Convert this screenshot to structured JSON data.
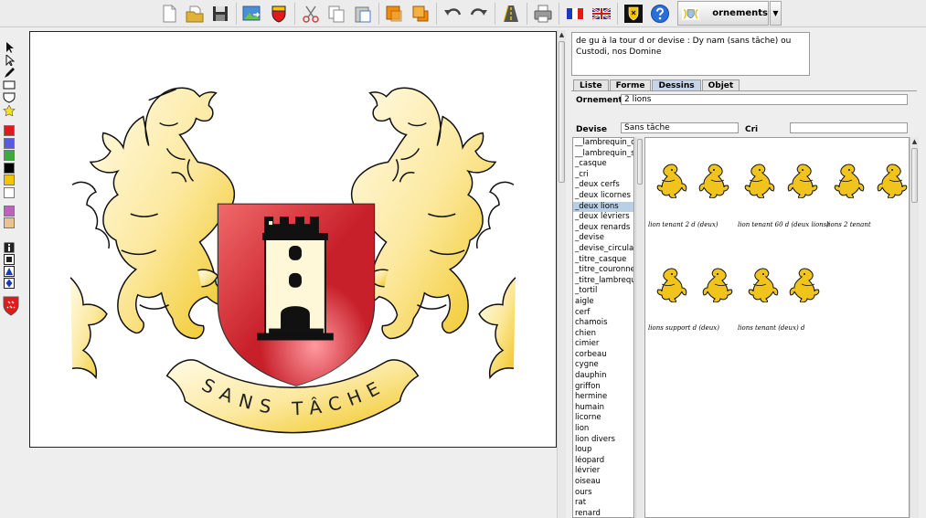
{
  "toolbar": {
    "buttons": [
      {
        "name": "new-document-icon"
      },
      {
        "name": "open-folder-icon"
      },
      {
        "name": "save-icon"
      },
      {
        "name": "export-image-icon"
      },
      {
        "name": "shield-icon"
      },
      {
        "name": "cut-icon"
      },
      {
        "name": "copy-icon"
      },
      {
        "name": "paste-icon"
      },
      {
        "name": "bring-forward-icon"
      },
      {
        "name": "send-backward-icon"
      },
      {
        "name": "undo-icon"
      },
      {
        "name": "redo-icon"
      },
      {
        "name": "road-icon"
      },
      {
        "name": "print-icon"
      },
      {
        "name": "french-flag-icon"
      },
      {
        "name": "uk-flag-icon"
      },
      {
        "name": "coat-of-arms-icon"
      },
      {
        "name": "help-icon"
      }
    ],
    "ornaments_label": "ornements"
  },
  "colors": {
    "palette": [
      "#e31a1a",
      "#5a5ae0",
      "#35b035",
      "#000000",
      "#f5c400",
      "#ffffff",
      "#c060c0",
      "#e8c48c"
    ],
    "shield": "#c8202a",
    "gold": "#f0c41c"
  },
  "blazon": "de gu à la tour d or devise : Dy nam (sans tâche) ou Custodi, nos Domine",
  "tabs": [
    {
      "label": "Liste",
      "active": false
    },
    {
      "label": "Forme",
      "active": false
    },
    {
      "label": "Dessins",
      "active": true
    },
    {
      "label": "Objet",
      "active": false
    }
  ],
  "fields": {
    "ornements_label": "Ornements",
    "ornements_value": "2 lions",
    "devise_label": "Devise",
    "devise_value": "Sans tâche",
    "cri_label": "Cri",
    "cri_value": ""
  },
  "motto": "SANS TÂCHE",
  "list_items": [
    {
      "label": "__lambrequin_c",
      "selected": false
    },
    {
      "label": "__lambrequin_sc",
      "selected": false
    },
    {
      "label": "_casque",
      "selected": false
    },
    {
      "label": "_cri",
      "selected": false
    },
    {
      "label": "_deux cerfs",
      "selected": false
    },
    {
      "label": "_deux licornes",
      "selected": false
    },
    {
      "label": "_deux lions",
      "selected": true
    },
    {
      "label": "_deux lévriers",
      "selected": false
    },
    {
      "label": "_deux renards",
      "selected": false
    },
    {
      "label": "_devise",
      "selected": false
    },
    {
      "label": "_devise_circulaire",
      "selected": false
    },
    {
      "label": "_titre_casque",
      "selected": false
    },
    {
      "label": "_titre_couronne",
      "selected": false
    },
    {
      "label": "_titre_lambrequin",
      "selected": false
    },
    {
      "label": "_tortil",
      "selected": false
    },
    {
      "label": "aigle",
      "selected": false
    },
    {
      "label": "cerf",
      "selected": false
    },
    {
      "label": "chamois",
      "selected": false
    },
    {
      "label": "chien",
      "selected": false
    },
    {
      "label": "cimier",
      "selected": false
    },
    {
      "label": "corbeau",
      "selected": false
    },
    {
      "label": "cygne",
      "selected": false
    },
    {
      "label": "dauphin",
      "selected": false
    },
    {
      "label": "griffon",
      "selected": false
    },
    {
      "label": "hermine",
      "selected": false
    },
    {
      "label": "humain",
      "selected": false
    },
    {
      "label": "licorne",
      "selected": false
    },
    {
      "label": "lion",
      "selected": false
    },
    {
      "label": "lion divers",
      "selected": false
    },
    {
      "label": "loup",
      "selected": false
    },
    {
      "label": "léopard",
      "selected": false
    },
    {
      "label": "lévrier",
      "selected": false
    },
    {
      "label": "oiseau",
      "selected": false
    },
    {
      "label": "ours",
      "selected": false
    },
    {
      "label": "rat",
      "selected": false
    },
    {
      "label": "renard",
      "selected": false
    }
  ],
  "thumbnails": {
    "captions": [
      "lion tenant 2 d (deux)",
      "lion tenant 60 d (deux lions)",
      "lions 2 tenant",
      "lions support d (deux)",
      "lions tenant (deux) d"
    ]
  }
}
